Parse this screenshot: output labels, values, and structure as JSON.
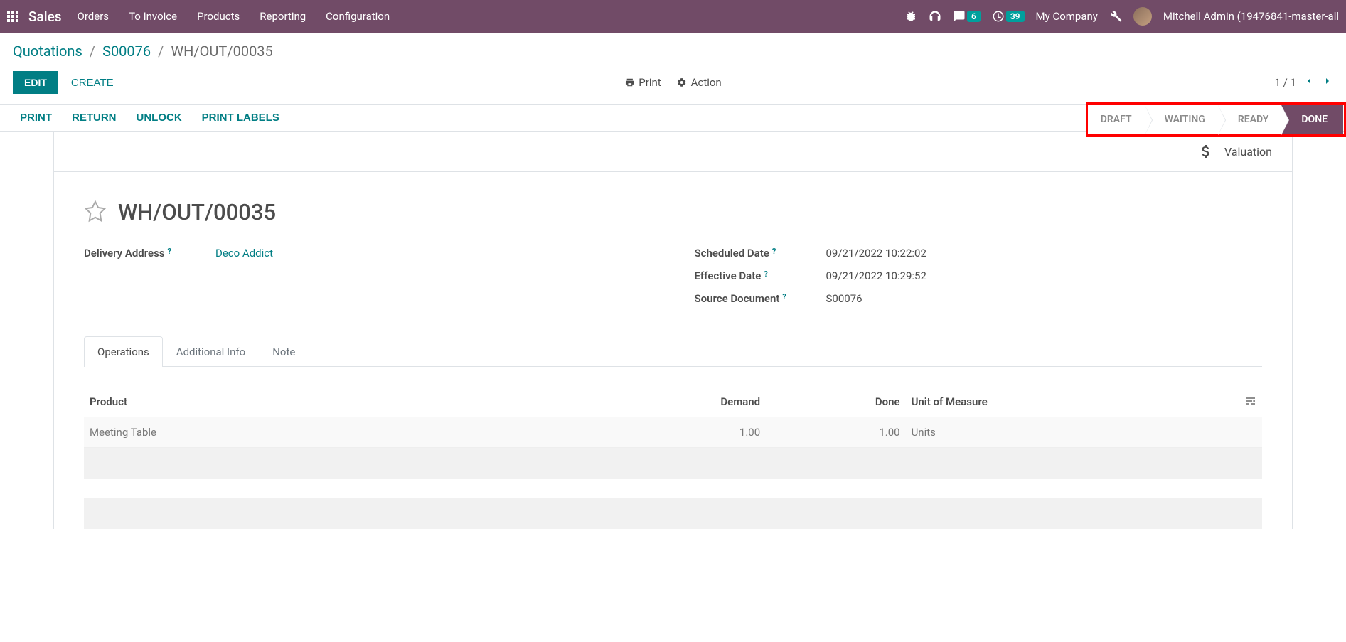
{
  "navbar": {
    "app_name": "Sales",
    "menu": [
      "Orders",
      "To Invoice",
      "Products",
      "Reporting",
      "Configuration"
    ],
    "msg_badge": "6",
    "clock_badge": "39",
    "company": "My Company",
    "user": "Mitchell Admin (19476841-master-all"
  },
  "breadcrumb": {
    "root": "Quotations",
    "order": "S00076",
    "current": "WH/OUT/00035"
  },
  "control": {
    "edit": "EDIT",
    "create": "CREATE",
    "print": "Print",
    "action": "Action",
    "pager": "1 / 1"
  },
  "actions": {
    "print": "PRINT",
    "return": "RETURN",
    "unlock": "UNLOCK",
    "print_labels": "PRINT LABELS"
  },
  "status": {
    "draft": "DRAFT",
    "waiting": "WAITING",
    "ready": "READY",
    "done": "DONE"
  },
  "stat_buttons": {
    "valuation": "Valuation"
  },
  "record": {
    "title": "WH/OUT/00035",
    "delivery_address_label": "Delivery Address",
    "delivery_address_value": "Deco Addict",
    "scheduled_date_label": "Scheduled Date",
    "scheduled_date_value": "09/21/2022 10:22:02",
    "effective_date_label": "Effective Date",
    "effective_date_value": "09/21/2022 10:29:52",
    "source_doc_label": "Source Document",
    "source_doc_value": "S00076"
  },
  "tabs": {
    "operations": "Operations",
    "additional": "Additional Info",
    "note": "Note"
  },
  "table": {
    "headers": {
      "product": "Product",
      "demand": "Demand",
      "done": "Done",
      "uom": "Unit of Measure"
    },
    "rows": [
      {
        "product": "Meeting Table",
        "demand": "1.00",
        "done": "1.00",
        "uom": "Units"
      }
    ]
  }
}
